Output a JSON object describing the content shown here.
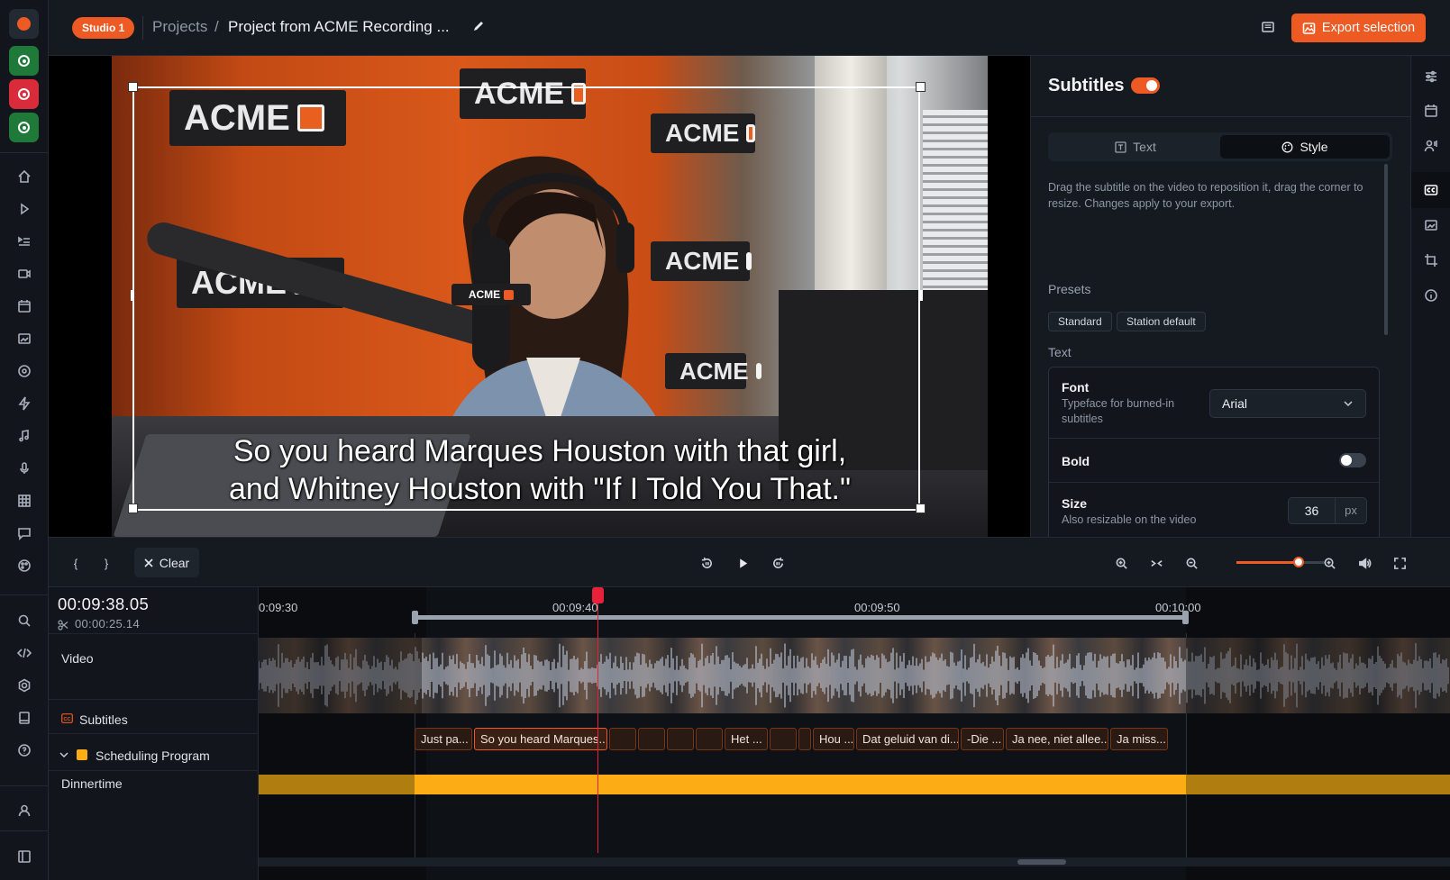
{
  "topbar": {
    "workspace_badge": "Studio 1",
    "breadcrumb_root": "Projects",
    "breadcrumb_sep": "/",
    "project_title": "Project from ACME Recording ...",
    "export_label": "Export selection"
  },
  "video": {
    "subtitle_line1": "So you heard Marques Houston with that girl,",
    "subtitle_line2": "and Whitney Houston with \"If I Told You That.\"",
    "brand_text": "ACME"
  },
  "panel": {
    "title": "Subtitles",
    "enabled": true,
    "tabs": [
      "Text",
      "Style"
    ],
    "active_tab": "Style",
    "help_text": "Drag the subtitle on the video to reposition it, drag the corner to resize. Changes apply to your export.",
    "presets_label": "Presets",
    "presets": [
      "Standard",
      "Station default"
    ],
    "text_section_label": "Text",
    "font_label": "Font",
    "font_desc": "Typeface for burned-in subtitles",
    "font_value": "Arial",
    "bold_label": "Bold",
    "bold_on": false,
    "size_label": "Size",
    "size_desc": "Also resizable on the video",
    "size_value": "36",
    "size_unit": "px",
    "size_slider_fraction": 0.23
  },
  "transport": {
    "mark_in": "{",
    "mark_out": "}",
    "clear_label": "Clear",
    "zoom_fraction": 0.7
  },
  "timeline": {
    "timecode": "00:09:38.05",
    "duration": "00:00:25.14",
    "ticks": [
      "0:09:30",
      "00:09:40",
      "00:09:50",
      "00:10:00"
    ],
    "tracks": {
      "video": "Video",
      "subtitles": "Subtitles",
      "group": "Scheduling Program",
      "program": "Dinnertime"
    },
    "subtitle_clips": [
      "Just pa...",
      "So you heard Marques...",
      "",
      "",
      "",
      "",
      "Het ...",
      "",
      "",
      "Hou ...",
      "Dat geluid van di...",
      "-Die ...",
      "Ja nee, niet allee...",
      "Ja miss..."
    ]
  },
  "colors": {
    "accent": "#ee5a24",
    "playhead": "#e8213a",
    "program_bar": "#fcac14"
  }
}
